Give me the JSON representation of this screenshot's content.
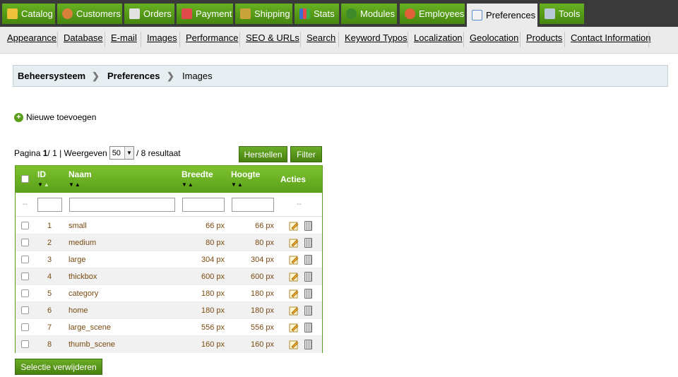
{
  "top_tabs": [
    {
      "label": "Catalog",
      "icon": "catalog-icon",
      "active": false
    },
    {
      "label": "Customers",
      "icon": "customers-icon",
      "active": false
    },
    {
      "label": "Orders",
      "icon": "orders-icon",
      "active": false
    },
    {
      "label": "Payment",
      "icon": "payment-icon",
      "active": false
    },
    {
      "label": "Shipping",
      "icon": "shipping-icon",
      "active": false
    },
    {
      "label": "Stats",
      "icon": "stats-icon",
      "active": false
    },
    {
      "label": "Modules",
      "icon": "modules-icon",
      "active": false
    },
    {
      "label": "Employees",
      "icon": "employees-icon",
      "active": false
    },
    {
      "label": "Preferences",
      "icon": "preferences-icon",
      "active": true
    },
    {
      "label": "Tools",
      "icon": "tools-icon",
      "active": false
    }
  ],
  "sub_tabs": [
    "Appearance",
    "Database",
    "E-mail",
    "Images",
    "Performance",
    "SEO & URLs",
    "Search",
    "Keyword Typos",
    "Localization",
    "Geolocation",
    "Products",
    "Contact Information"
  ],
  "breadcrumb": {
    "items": [
      "Beheersysteem",
      "Preferences",
      "Images"
    ]
  },
  "add_new_label": "Nieuwe toevoegen",
  "pagination": {
    "prefix": "Pagina",
    "page": "1",
    "sep": " / 1 | Weergeven",
    "per_page": "50",
    "results": "/ 8 resultaat"
  },
  "buttons": {
    "reset": "Herstellen",
    "filter": "Filter",
    "delete_selection": "Selectie verwijderen"
  },
  "table": {
    "headers": {
      "id": "ID",
      "name": "Naam",
      "width": "Breedte",
      "height": "Hoogte",
      "actions": "Acties"
    },
    "filter_placeholder": "--",
    "rows": [
      {
        "id": "1",
        "name": "small",
        "width": "66 px",
        "height": "66 px"
      },
      {
        "id": "2",
        "name": "medium",
        "width": "80 px",
        "height": "80 px"
      },
      {
        "id": "3",
        "name": "large",
        "width": "304 px",
        "height": "304 px"
      },
      {
        "id": "4",
        "name": "thickbox",
        "width": "600 px",
        "height": "600 px"
      },
      {
        "id": "5",
        "name": "category",
        "width": "180 px",
        "height": "180 px"
      },
      {
        "id": "6",
        "name": "home",
        "width": "180 px",
        "height": "180 px"
      },
      {
        "id": "7",
        "name": "large_scene",
        "width": "556 px",
        "height": "556 px"
      },
      {
        "id": "8",
        "name": "thumb_scene",
        "width": "160 px",
        "height": "160 px"
      }
    ]
  },
  "colors": {
    "accent": "#5aa019",
    "topbar": "#3a3a3a",
    "link": "#7a4a10"
  }
}
